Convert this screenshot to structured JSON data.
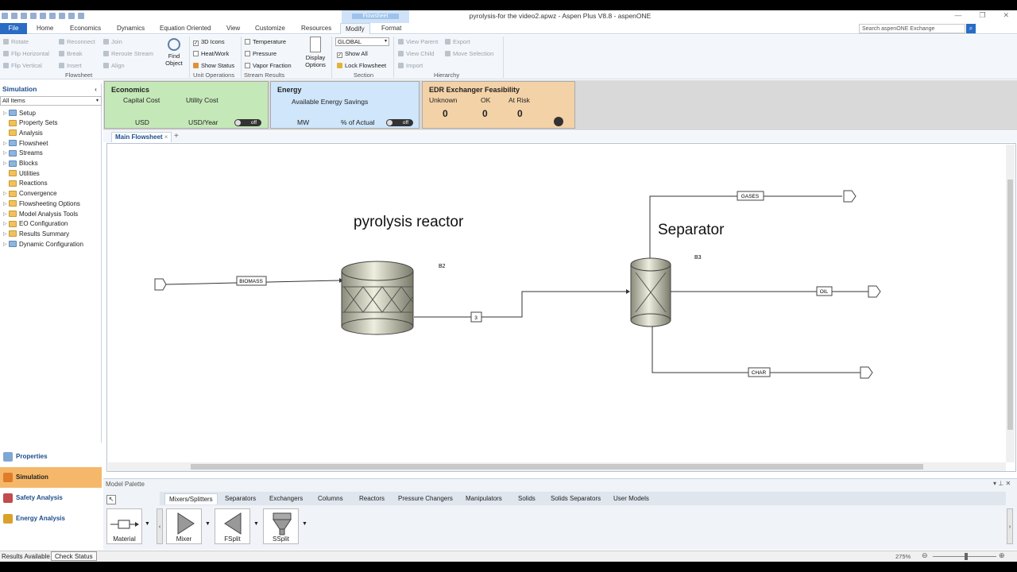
{
  "window": {
    "title": "pyrolysis-for the video2.apwz - Aspen Plus V8.8 - aspenONE",
    "context_tab": "Flowsheet"
  },
  "ribbon_tabs": [
    "File",
    "Home",
    "Economics",
    "Dynamics",
    "Equation Oriented",
    "View",
    "Customize",
    "Resources",
    "Modify",
    "Format"
  ],
  "active_tab": "Modify",
  "search": {
    "placeholder": "Search aspenONE Exchange"
  },
  "ribbon": {
    "flowsheet_group": {
      "label": "Flowsheet",
      "rotate": "Rotate",
      "flip_horizontal": "Flip Horizontal",
      "flip_vertical": "Flip Vertical",
      "reconnect": "Reconnect",
      "break": "Break",
      "insert": "Insert",
      "join": "Join",
      "reroute": "Reroute Stream",
      "align": "Align",
      "find_object": "Find Object"
    },
    "unit_ops_group": {
      "label": "Unit Operations",
      "icons_3d": "3D Icons",
      "heat_work": "Heat/Work",
      "show_status": "Show Status"
    },
    "stream_group": {
      "label": "Stream Results",
      "temperature": "Temperature",
      "pressure": "Pressure",
      "vapor_fraction": "Vapor Fraction",
      "display_options": "Display Options"
    },
    "section_group": {
      "label": "Section",
      "select_value": "GLOBAL",
      "show_all": "Show All",
      "lock": "Lock Flowsheet"
    },
    "hierarchy_group": {
      "label": "Hierarchy",
      "view_parent": "View Parent",
      "view_child": "View Child",
      "import": "Import",
      "export": "Export",
      "move_selection": "Move Selection"
    }
  },
  "nav": {
    "header": "Simulation",
    "selector": "All Items",
    "items": [
      {
        "label": "Setup",
        "folder": "b",
        "expand": true
      },
      {
        "label": "Property Sets",
        "folder": "y",
        "expand": false
      },
      {
        "label": "Analysis",
        "folder": "y",
        "expand": false
      },
      {
        "label": "Flowsheet",
        "folder": "b",
        "expand": true
      },
      {
        "label": "Streams",
        "folder": "b",
        "expand": true
      },
      {
        "label": "Blocks",
        "folder": "b",
        "expand": true
      },
      {
        "label": "Utilities",
        "folder": "y",
        "expand": false
      },
      {
        "label": "Reactions",
        "folder": "y",
        "expand": false
      },
      {
        "label": "Convergence",
        "folder": "y",
        "expand": true
      },
      {
        "label": "Flowsheeting Options",
        "folder": "y",
        "expand": true
      },
      {
        "label": "Model Analysis Tools",
        "folder": "y",
        "expand": true
      },
      {
        "label": "EO Configuration",
        "folder": "y",
        "expand": true
      },
      {
        "label": "Results Summary",
        "folder": "y",
        "expand": true
      },
      {
        "label": "Dynamic Configuration",
        "folder": "b",
        "expand": true
      }
    ],
    "bottom": [
      "Properties",
      "Simulation",
      "Safety Analysis",
      "Energy Analysis"
    ],
    "bottom_active": "Simulation"
  },
  "dashboard": {
    "economics": {
      "title": "Economics",
      "capital": "Capital Cost",
      "utility": "Utility Cost",
      "capital_unit": "USD",
      "utility_unit": "USD/Year",
      "toggle": "off"
    },
    "energy": {
      "title": "Energy",
      "savings": "Available Energy Savings",
      "unit1": "MW",
      "unit2": "% of Actual",
      "toggle": "off"
    },
    "edr": {
      "title": "EDR Exchanger Feasibility",
      "unknown_label": "Unknown",
      "ok_label": "OK",
      "risk_label": "At Risk",
      "unknown": "0",
      "ok": "0",
      "risk": "0"
    },
    "colors": {
      "economics": "#c5e8b8",
      "energy": "#cfe6fb",
      "edr": "#f3d2a8"
    }
  },
  "doc_tab": "Main Flowsheet",
  "flowsheet": {
    "reactor_title": "pyrolysis reactor",
    "separator_title": "Separator",
    "block_reactor": "B2",
    "block_separator": "B3",
    "streams": {
      "feed": "BIOMASS",
      "mid": "3",
      "gases": "GASES",
      "oil": "OIL",
      "char": "CHAR"
    }
  },
  "palette": {
    "title": "Model Palette",
    "tabs": [
      "Mixers/Splitters",
      "Separators",
      "Exchangers",
      "Columns",
      "Reactors",
      "Pressure Changers",
      "Manipulators",
      "Solids",
      "Solids Separators",
      "User Models"
    ],
    "active": "Mixers/Splitters",
    "items": [
      "Material",
      "Mixer",
      "FSplit",
      "SSplit"
    ]
  },
  "status": {
    "results": "Results Available",
    "check": "Check Status",
    "zoom": "275%"
  }
}
